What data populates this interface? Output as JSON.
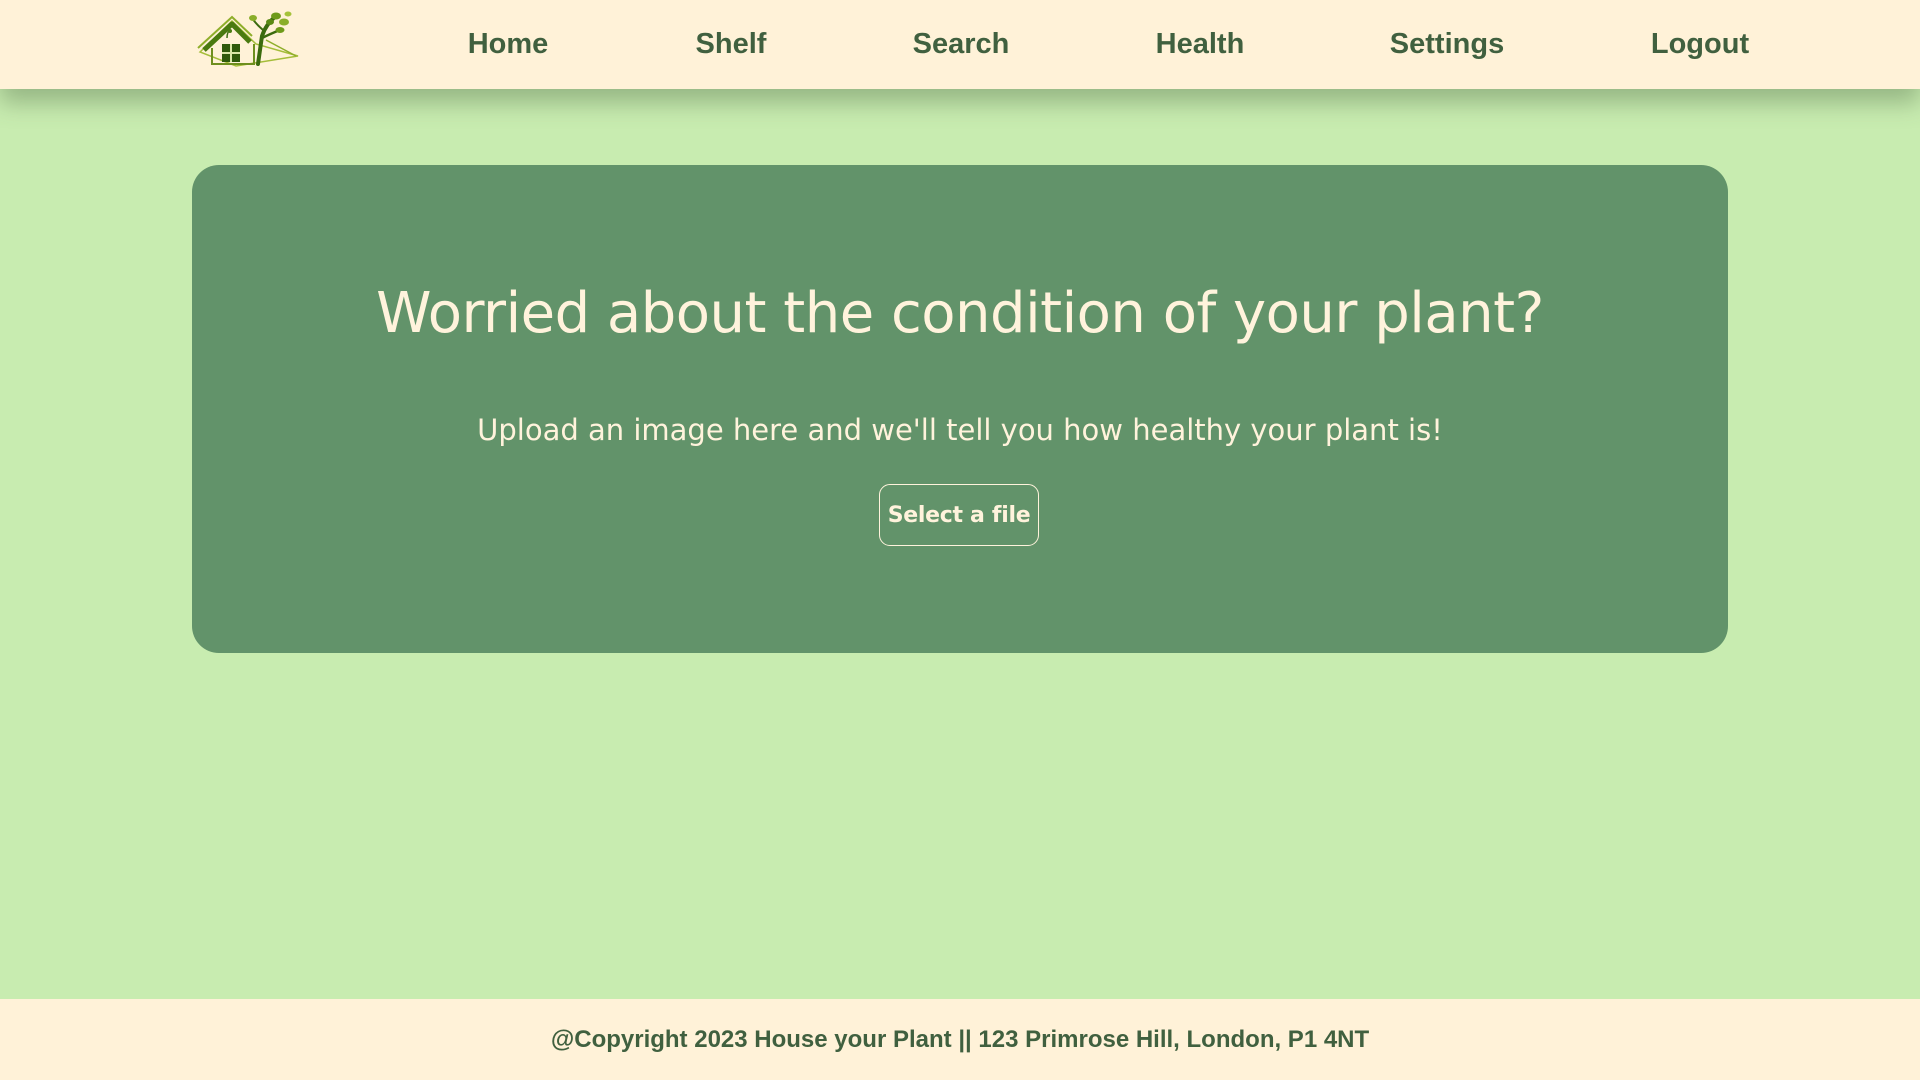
{
  "nav": {
    "logo_icon": "house-with-tree-logo",
    "items": [
      {
        "label": "Home"
      },
      {
        "label": "Shelf"
      },
      {
        "label": "Search"
      },
      {
        "label": "Health"
      },
      {
        "label": "Settings"
      },
      {
        "label": "Logout"
      }
    ]
  },
  "hero": {
    "title": "Worried about the condition of your plant?",
    "subtitle": "Upload an image here and we'll tell you how healthy your plant is!",
    "button_label": "Select a file"
  },
  "footer": {
    "text": "@Copyright 2023 House your Plant || 123 Primrose Hill, London, P1 4NT"
  },
  "colors": {
    "page_background": "#c8ecb0",
    "nav_background": "#fff2d8",
    "nav_text": "#40603f",
    "hero_background": "#62936a",
    "hero_text": "#fff3dc"
  }
}
